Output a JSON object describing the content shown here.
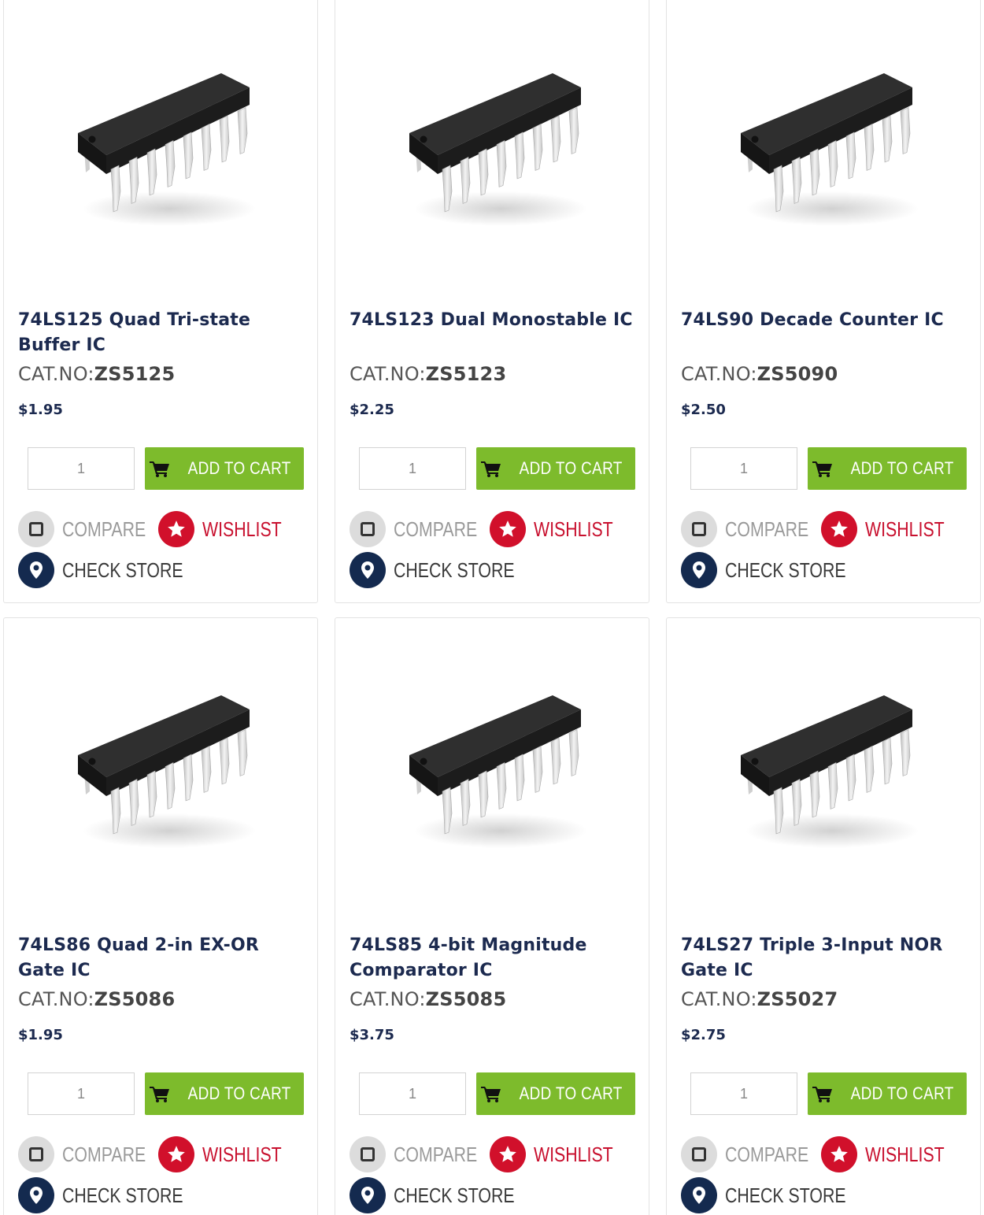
{
  "labels": {
    "add_to_cart": "ADD TO CART",
    "compare": "COMPARE",
    "wishlist": "WISHLIST",
    "check_store": "CHECK STORE",
    "cat_prefix": "CAT.NO:"
  },
  "colors": {
    "cart_green": "#7dbb2c",
    "wishlist_red": "#d1102b",
    "store_navy": "#142a4f",
    "title_navy": "#1c2a4f"
  },
  "icons": {
    "cart": "cart-icon",
    "compare": "checkbox-icon",
    "wishlist": "star-icon",
    "store": "map-pin-icon",
    "product": "dip-ic-chip-image"
  },
  "products": [
    {
      "title": "74LS125 Quad Tri-state Buffer IC",
      "cat_no": "ZS5125",
      "price": "$1.95",
      "qty": "1"
    },
    {
      "title": "74LS123 Dual Monostable IC",
      "cat_no": "ZS5123",
      "price": "$2.25",
      "qty": "1"
    },
    {
      "title": "74LS90 Decade Counter IC",
      "cat_no": "ZS5090",
      "price": "$2.50",
      "qty": "1"
    },
    {
      "title": "74LS86 Quad 2-in EX-OR Gate IC",
      "cat_no": "ZS5086",
      "price": "$1.95",
      "qty": "1"
    },
    {
      "title": "74LS85 4-bit Magnitude Comparator IC",
      "cat_no": "ZS5085",
      "price": "$3.75",
      "qty": "1"
    },
    {
      "title": "74LS27 Triple 3-Input NOR Gate IC",
      "cat_no": "ZS5027",
      "price": "$2.75",
      "qty": "1"
    }
  ]
}
